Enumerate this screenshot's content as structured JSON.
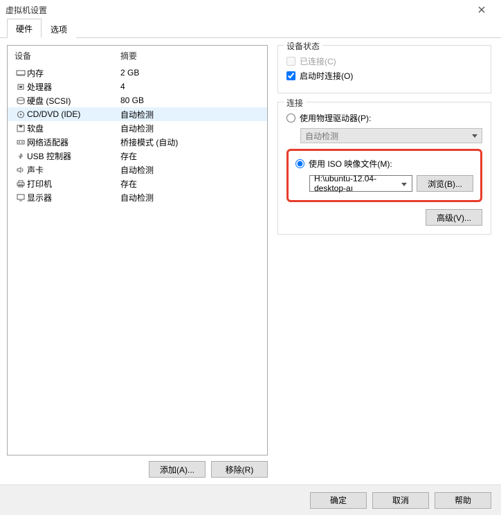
{
  "window": {
    "title": "虚拟机设置"
  },
  "tabs": {
    "hardware": "硬件",
    "options": "选项"
  },
  "list": {
    "header_device": "设备",
    "header_summary": "摘要",
    "rows": [
      {
        "icon": "memory",
        "name": "内存",
        "summary": "2 GB"
      },
      {
        "icon": "cpu",
        "name": "处理器",
        "summary": "4"
      },
      {
        "icon": "disk",
        "name": "硬盘 (SCSI)",
        "summary": "80 GB"
      },
      {
        "icon": "cd",
        "name": "CD/DVD (IDE)",
        "summary": "自动检测"
      },
      {
        "icon": "floppy",
        "name": "软盘",
        "summary": "自动检测"
      },
      {
        "icon": "net",
        "name": "网络适配器",
        "summary": "桥接模式 (自动)"
      },
      {
        "icon": "usb",
        "name": "USB 控制器",
        "summary": "存在"
      },
      {
        "icon": "sound",
        "name": "声卡",
        "summary": "自动检测"
      },
      {
        "icon": "printer",
        "name": "打印机",
        "summary": "存在"
      },
      {
        "icon": "display",
        "name": "显示器",
        "summary": "自动检测"
      }
    ],
    "selected_index": 3
  },
  "left_buttons": {
    "add": "添加(A)...",
    "remove": "移除(R)"
  },
  "status_group": {
    "legend": "设备状态",
    "connected": "已连接(C)",
    "connected_checked": false,
    "connected_disabled": true,
    "connect_power": "启动时连接(O)",
    "connect_power_checked": true
  },
  "conn_group": {
    "legend": "连接",
    "use_physical": "使用物理驱动器(P):",
    "physical_value": "自动检测",
    "use_iso": "使用 ISO 映像文件(M):",
    "iso_value": "H:\\ubuntu-12.04-desktop-aı",
    "browse": "浏览(B)...",
    "selected": "iso"
  },
  "advanced": "高级(V)...",
  "footer": {
    "ok": "确定",
    "cancel": "取消",
    "help": "帮助"
  }
}
